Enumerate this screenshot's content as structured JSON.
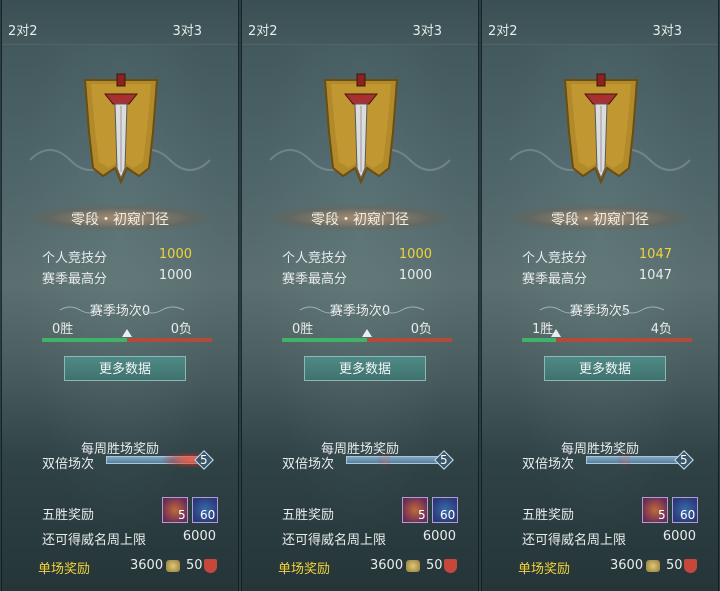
{
  "panels": [
    {
      "tabs": [
        "2对2",
        "3对3"
      ],
      "rank_name": "零段・初窥门径",
      "personal_score_label": "个人竞技分",
      "personal_score": "1000",
      "season_high_label": "赛季最高分",
      "season_high": "1000",
      "season_matches": "赛季场次0",
      "wins": "0胜",
      "losses": "0负",
      "win_ratio": 0.5,
      "more_data": "更多数据",
      "weekly_title": "每周胜场奖励",
      "double_label": "双倍场次",
      "double_count": "5",
      "double_glow": true,
      "five_win_label": "五胜奖励",
      "reward_1_count": "5",
      "reward_2_count": "60",
      "fame_cap_label": "还可得威名周上限",
      "fame_cap": "6000",
      "single_reward_label": "单场奖励",
      "single_reward_1": "3600",
      "single_reward_2": "50"
    },
    {
      "tabs": [
        "2对2",
        "3对3"
      ],
      "rank_name": "零段・初窥门径",
      "personal_score_label": "个人竞技分",
      "personal_score": "1000",
      "season_high_label": "赛季最高分",
      "season_high": "1000",
      "season_matches": "赛季场次0",
      "wins": "0胜",
      "losses": "0负",
      "win_ratio": 0.5,
      "more_data": "更多数据",
      "weekly_title": "每周胜场奖励",
      "double_label": "双倍场次",
      "double_count": "5",
      "double_glow": false,
      "five_win_label": "五胜奖励",
      "reward_1_count": "5",
      "reward_2_count": "60",
      "fame_cap_label": "还可得威名周上限",
      "fame_cap": "6000",
      "single_reward_label": "单场奖励",
      "single_reward_1": "3600",
      "single_reward_2": "50"
    },
    {
      "tabs": [
        "2对2",
        "3对3"
      ],
      "rank_name": "零段・初窥门径",
      "personal_score_label": "个人竞技分",
      "personal_score": "1047",
      "season_high_label": "赛季最高分",
      "season_high": "1047",
      "season_matches": "赛季场次5",
      "wins": "1胜",
      "losses": "4负",
      "win_ratio": 0.2,
      "more_data": "更多数据",
      "weekly_title": "每周胜场奖励",
      "double_label": "双倍场次",
      "double_count": "5",
      "double_glow": false,
      "five_win_label": "五胜奖励",
      "reward_1_count": "5",
      "reward_2_count": "60",
      "fame_cap_label": "还可得威名周上限",
      "fame_cap": "6000",
      "single_reward_label": "单场奖励",
      "single_reward_1": "3600",
      "single_reward_2": "50"
    }
  ],
  "colors": {
    "gold": "#f3d33a",
    "single_reward": "#f3d33a",
    "win_bar": "#3fb36a",
    "loss_bar": "#b34a3a"
  },
  "icons": [
    "sword-banner-emblem",
    "treasure-chest-icon",
    "axe-icon",
    "coin-icon",
    "shield-icon"
  ]
}
